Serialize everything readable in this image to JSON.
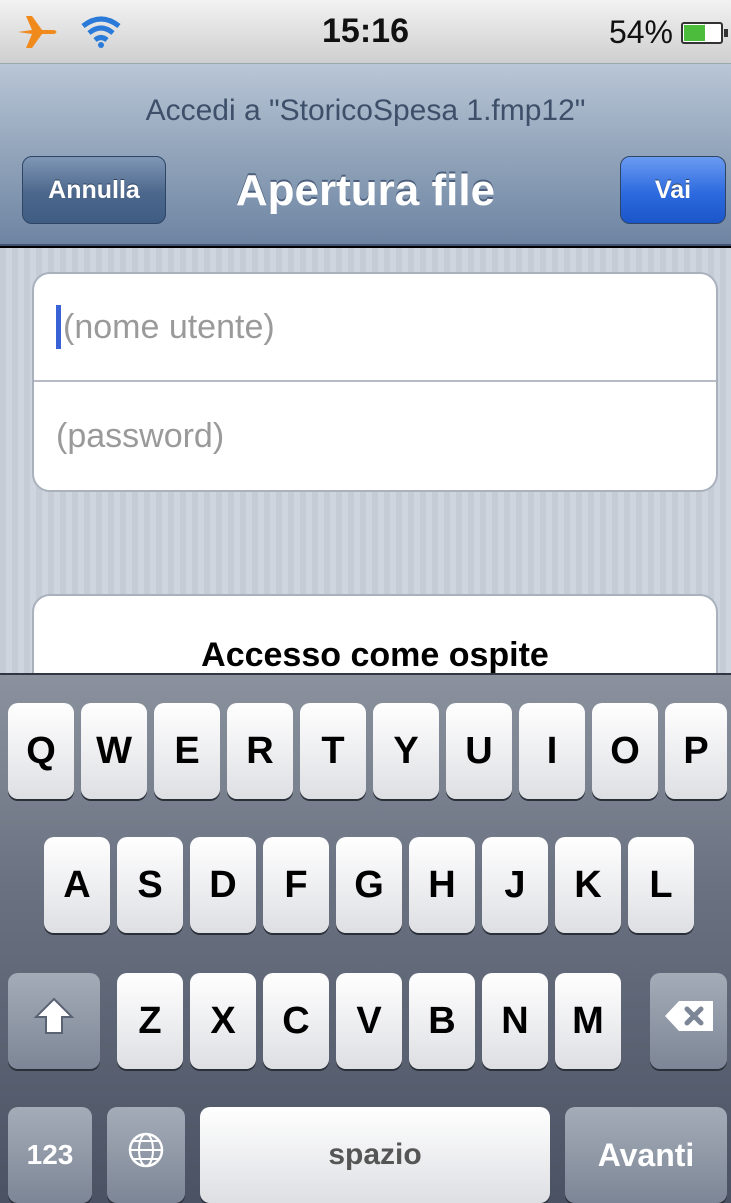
{
  "status_bar": {
    "time": "15:16",
    "battery_percent": "54%",
    "icons": [
      "airplane-icon",
      "wifi-icon",
      "battery-icon"
    ]
  },
  "nav": {
    "prompt": "Accedi a \"StoricoSpesa 1.fmp12\"",
    "title": "Apertura file",
    "cancel_label": "Annulla",
    "go_label": "Vai"
  },
  "form": {
    "username_placeholder": "(nome utente)",
    "password_placeholder": "(password)",
    "guest_label": "Accesso come ospite"
  },
  "keyboard": {
    "row1": [
      "Q",
      "W",
      "E",
      "R",
      "T",
      "Y",
      "U",
      "I",
      "O",
      "P"
    ],
    "row2": [
      "A",
      "S",
      "D",
      "F",
      "G",
      "H",
      "J",
      "K",
      "L"
    ],
    "row3": [
      "Z",
      "X",
      "C",
      "V",
      "B",
      "N",
      "M"
    ],
    "numbers_label": "123",
    "space_label": "spazio",
    "next_label": "Avanti"
  },
  "colors": {
    "nav_gradient": "#8ea1b8",
    "go_button": "#2d6adf",
    "caret": "#3a62d7",
    "battery": "#4cbc3c"
  }
}
